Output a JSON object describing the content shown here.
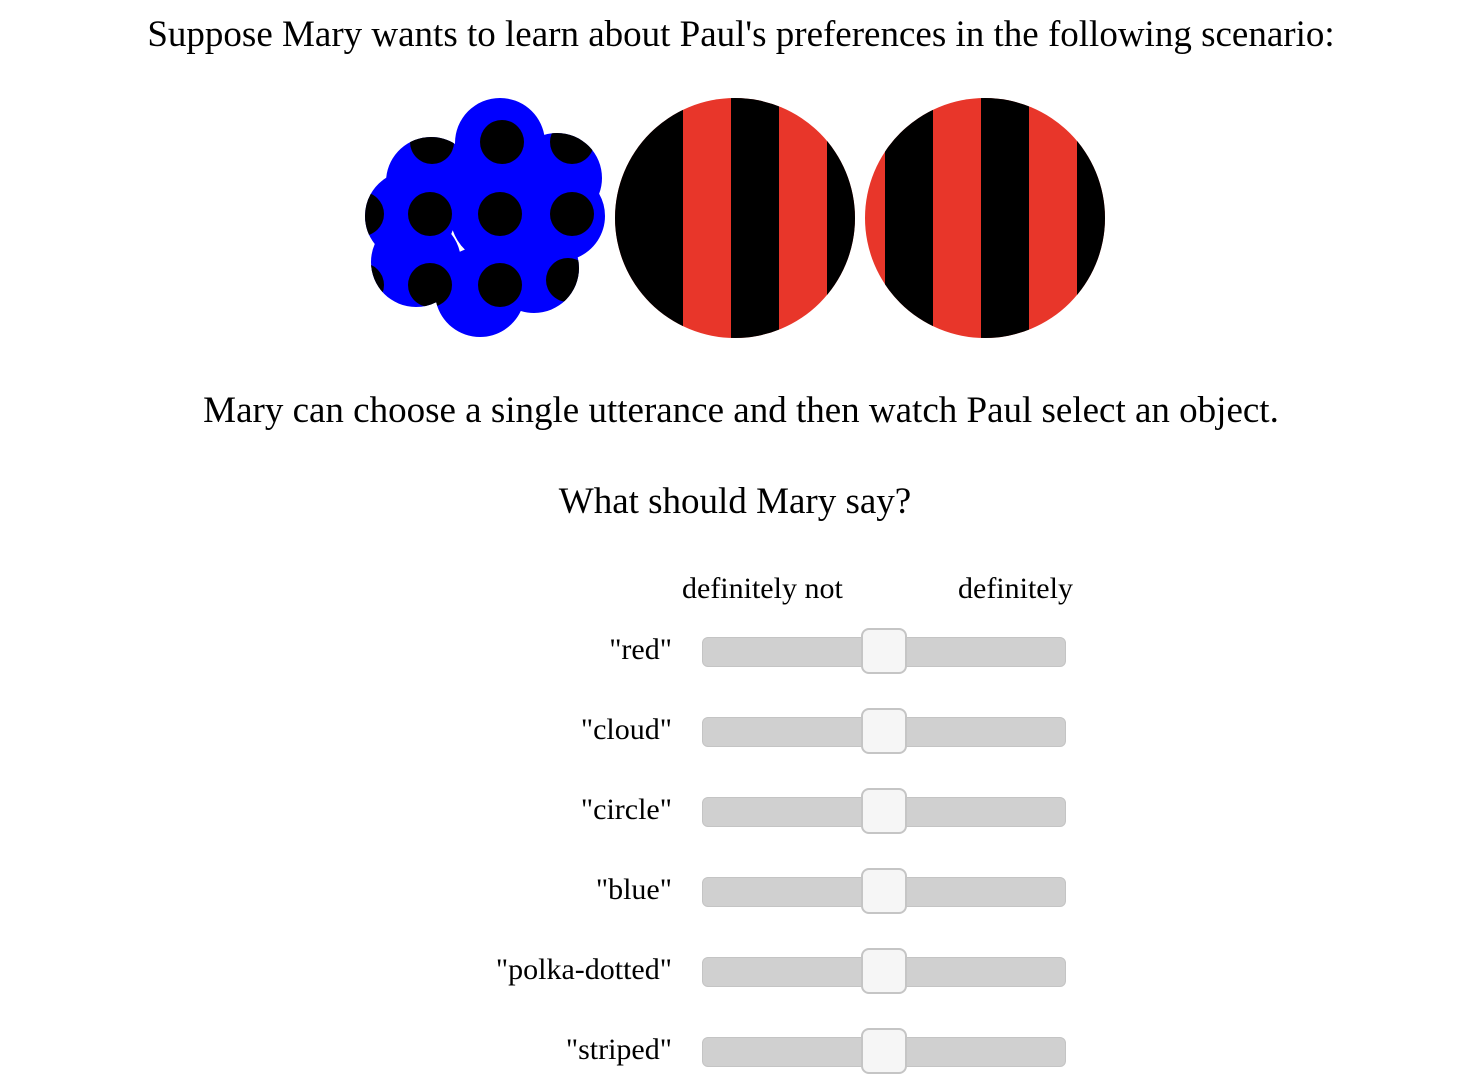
{
  "intro_text": "Suppose Mary wants to learn about Paul's preferences in the following scenario:",
  "objects": [
    {
      "shape": "cloud",
      "color": "blue",
      "texture": "polka-dotted",
      "fill_hex": "#0000ff",
      "pattern_hex": "#000000"
    },
    {
      "shape": "circle",
      "color": "red",
      "texture": "striped",
      "fill_hex": "#e8362a",
      "pattern_hex": "#000000"
    },
    {
      "shape": "circle",
      "color": "red",
      "texture": "striped",
      "fill_hex": "#e8362a",
      "pattern_hex": "#000000"
    }
  ],
  "instructions": "Mary can choose a single utterance and then watch Paul select an object.",
  "question": "What should Mary say?",
  "scale": {
    "left_label": "definitely not",
    "right_label": "definitely"
  },
  "utterances": [
    {
      "label": "\"red\"",
      "value": 0.5
    },
    {
      "label": "\"cloud\"",
      "value": 0.5
    },
    {
      "label": "\"circle\"",
      "value": 0.5
    },
    {
      "label": "\"blue\"",
      "value": 0.5
    },
    {
      "label": "\"polka-dotted\"",
      "value": 0.5
    },
    {
      "label": "\"striped\"",
      "value": 0.5
    }
  ]
}
